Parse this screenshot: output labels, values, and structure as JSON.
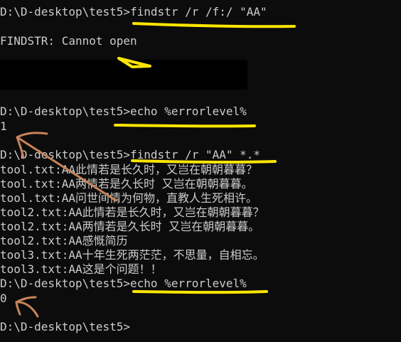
{
  "terminal": {
    "lines": [
      "D:\\D-desktop\\test5>findstr /r /f:/ \"AA\"",
      "FINDSTR: Cannot open",
      "D:\\D-desktop\\test5>echo %errorlevel%",
      "1",
      "D:\\D-desktop\\test5>findstr /r \"AA\" *.*",
      "tool.txt:AA此情若是长久时，又岂在朝朝暮暮？",
      "tool.txt:AA两情若是久长时 又岂在朝朝暮暮。",
      "tool.txt:AA问世间情为何物，直教人生死相许。",
      "tool2.txt:AA此情若是长久时，又岂在朝朝暮暮？",
      "tool2.txt:AA两情若是久长时 又岂在朝朝暮暮。",
      "tool2.txt:AA感慨简历",
      "tool3.txt:AA十年生死两茫茫，不思量，自相忘。",
      "tool3.txt:AA这是个问题！！",
      "D:\\D-desktop\\test5>echo %errorlevel%",
      "0",
      "D:\\D-desktop\\test5>"
    ]
  },
  "colors": {
    "background": "#0c0c0c",
    "text": "#cccccc",
    "highlight_yellow": "#ffe600",
    "arrow_brown": "#c8845a",
    "redaction": "#000000"
  }
}
